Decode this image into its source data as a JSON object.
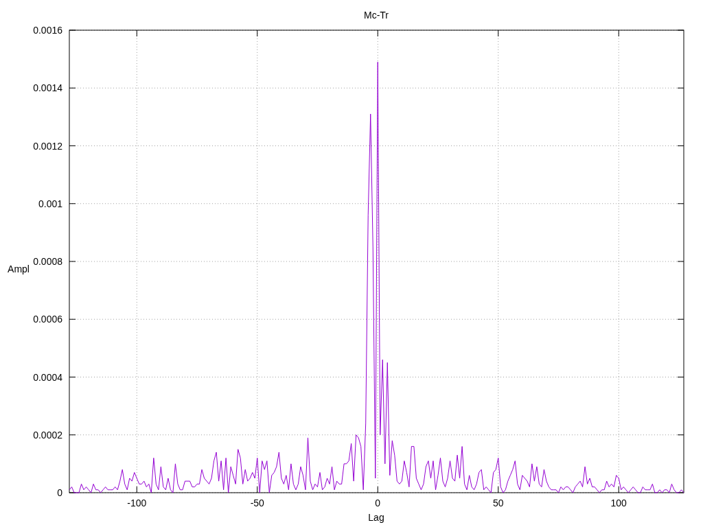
{
  "plot": {
    "chart_data": {
      "type": "line",
      "title": "Mc-Tr",
      "xlabel": "Lag",
      "ylabel": "Ampl",
      "xlim": [
        -128,
        127
      ],
      "ylim": [
        0,
        0.0016
      ],
      "xticks": [
        -100,
        -50,
        0,
        50,
        100
      ],
      "yticks": [
        {
          "value": 0,
          "label": "0"
        },
        {
          "value": 0.0002,
          "label": "0.0002"
        },
        {
          "value": 0.0004,
          "label": "0.0004"
        },
        {
          "value": 0.0006,
          "label": "0.0006"
        },
        {
          "value": 0.0008,
          "label": "0.0008"
        },
        {
          "value": 0.001,
          "label": "0.001"
        },
        {
          "value": 0.0012,
          "label": "0.0012"
        },
        {
          "value": 0.0014,
          "label": "0.0014"
        },
        {
          "value": 0.0016,
          "label": "0.0016"
        }
      ],
      "x": [
        -128,
        -127,
        -126,
        -125,
        -124,
        -123,
        -122,
        -121,
        -120,
        -119,
        -118,
        -117,
        -116,
        -115,
        -114,
        -113,
        -112,
        -111,
        -110,
        -109,
        -108,
        -107,
        -106,
        -105,
        -104,
        -103,
        -102,
        -101,
        -100,
        -99,
        -98,
        -97,
        -96,
        -95,
        -94,
        -93,
        -92,
        -91,
        -90,
        -89,
        -88,
        -87,
        -86,
        -85,
        -84,
        -83,
        -82,
        -81,
        -80,
        -79,
        -78,
        -77,
        -76,
        -75,
        -74,
        -73,
        -72,
        -71,
        -70,
        -69,
        -68,
        -67,
        -66,
        -65,
        -64,
        -63,
        -62,
        -61,
        -60,
        -59,
        -58,
        -57,
        -56,
        -55,
        -54,
        -53,
        -52,
        -51,
        -50,
        -49,
        -48,
        -47,
        -46,
        -45,
        -44,
        -43,
        -42,
        -41,
        -40,
        -39,
        -38,
        -37,
        -36,
        -35,
        -34,
        -33,
        -32,
        -31,
        -30,
        -29,
        -28,
        -27,
        -26,
        -25,
        -24,
        -23,
        -22,
        -21,
        -20,
        -19,
        -18,
        -17,
        -16,
        -15,
        -14,
        -13,
        -12,
        -11,
        -10,
        -9,
        -8,
        -7,
        -6,
        -5,
        -4,
        -3,
        -2,
        -1,
        0,
        1,
        2,
        3,
        4,
        5,
        6,
        7,
        8,
        9,
        10,
        11,
        12,
        13,
        14,
        15,
        16,
        17,
        18,
        19,
        20,
        21,
        22,
        23,
        24,
        25,
        26,
        27,
        28,
        29,
        30,
        31,
        32,
        33,
        34,
        35,
        36,
        37,
        38,
        39,
        40,
        41,
        42,
        43,
        44,
        45,
        46,
        47,
        48,
        49,
        50,
        51,
        52,
        53,
        54,
        55,
        56,
        57,
        58,
        59,
        60,
        61,
        62,
        63,
        64,
        65,
        66,
        67,
        68,
        69,
        70,
        71,
        72,
        73,
        74,
        75,
        76,
        77,
        78,
        79,
        80,
        81,
        82,
        83,
        84,
        85,
        86,
        87,
        88,
        89,
        90,
        91,
        92,
        93,
        94,
        95,
        96,
        97,
        98,
        99,
        100,
        101,
        102,
        103,
        104,
        105,
        106,
        107,
        108,
        109,
        110,
        111,
        112,
        113,
        114,
        115,
        116,
        117,
        118,
        119,
        120,
        121,
        122,
        123,
        124,
        125,
        126,
        127
      ],
      "grid": true,
      "series": [
        {
          "color": "#9400d3",
          "values": [
            1e-05,
            2e-05,
            0,
            0,
            0,
            3e-05,
            1e-05,
            2e-05,
            1e-05,
            0,
            3e-05,
            1e-05,
            1e-05,
            0,
            1e-05,
            2e-05,
            1e-05,
            1e-05,
            1e-05,
            2e-05,
            1e-05,
            4e-05,
            8e-05,
            3e-05,
            1e-05,
            5e-05,
            4e-05,
            7e-05,
            5e-05,
            3e-05,
            3e-05,
            4e-05,
            2e-05,
            3e-05,
            0,
            0.00012,
            3e-05,
            1e-05,
            9e-05,
            2e-05,
            1e-05,
            5e-05,
            1e-05,
            0,
            0.0001,
            3e-05,
            1e-05,
            1e-05,
            4e-05,
            4e-05,
            4e-05,
            2e-05,
            2e-05,
            3e-05,
            3e-05,
            8e-05,
            5e-05,
            4e-05,
            3e-05,
            5e-05,
            0.00011,
            0.00014,
            4e-05,
            0.00011,
            1e-05,
            0.00012,
            0,
            9e-05,
            6e-05,
            3e-05,
            0.00015,
            0.00012,
            3e-05,
            8e-05,
            4e-05,
            5e-05,
            7e-05,
            5e-05,
            0.00012,
            0,
            0.00011,
            8e-05,
            0.00011,
            0,
            6e-05,
            7e-05,
            9e-05,
            0.00014,
            5e-05,
            3e-05,
            6e-05,
            1e-05,
            0.0001,
            3e-05,
            1e-05,
            3e-05,
            9e-05,
            6e-05,
            1e-05,
            0.00019,
            4e-05,
            1e-05,
            3e-05,
            2e-05,
            7e-05,
            1e-05,
            2e-05,
            5e-05,
            3e-05,
            9e-05,
            1e-05,
            4e-05,
            3e-05,
            3e-05,
            0.0001,
            0.0001,
            0.00011,
            0.00017,
            4e-05,
            0.0002,
            0.00019,
            0.00016,
            1e-05,
            0.00024,
            0.00096,
            0.00131,
            0.00085,
            5e-05,
            0.00149,
            0.0002,
            0.00046,
            0.0001,
            0.00045,
            6e-05,
            0.00018,
            0.00013,
            4e-05,
            3e-05,
            4e-05,
            0.00011,
            7e-05,
            2e-05,
            0.00016,
            0.00016,
            5e-05,
            3e-05,
            1e-05,
            3e-05,
            9e-05,
            0.00011,
            5e-05,
            0.00011,
            1e-05,
            6e-05,
            0.00012,
            4e-05,
            2e-05,
            5e-05,
            0.00011,
            5e-05,
            4e-05,
            0.00013,
            5e-05,
            0.00016,
            3e-05,
            1e-05,
            6e-05,
            2e-05,
            1e-05,
            3e-05,
            7e-05,
            8e-05,
            1e-05,
            2e-05,
            1e-05,
            0,
            7e-05,
            8e-05,
            0.00012,
            2e-05,
            0,
            1e-05,
            4e-05,
            6e-05,
            8e-05,
            0.00011,
            3e-05,
            1e-05,
            6e-05,
            5e-05,
            4e-05,
            2e-05,
            0.0001,
            4e-05,
            9e-05,
            3e-05,
            2e-05,
            8e-05,
            4e-05,
            2e-05,
            1e-05,
            1e-05,
            1e-05,
            0,
            2e-05,
            1e-05,
            2e-05,
            2e-05,
            1e-05,
            0,
            2e-05,
            3e-05,
            4e-05,
            2e-05,
            9e-05,
            3e-05,
            5e-05,
            2e-05,
            2e-05,
            1e-05,
            0,
            1e-05,
            1e-05,
            4e-05,
            2e-05,
            3e-05,
            2e-05,
            6e-05,
            5e-05,
            1e-05,
            2e-05,
            1e-05,
            0,
            1e-05,
            2e-05,
            1e-05,
            0,
            0,
            2e-05,
            1e-05,
            1e-05,
            1e-05,
            3e-05,
            0,
            0,
            1e-05,
            0,
            1e-05,
            1e-05,
            0,
            3e-05,
            1e-05,
            0,
            0,
            1e-05,
            0
          ]
        }
      ]
    }
  }
}
